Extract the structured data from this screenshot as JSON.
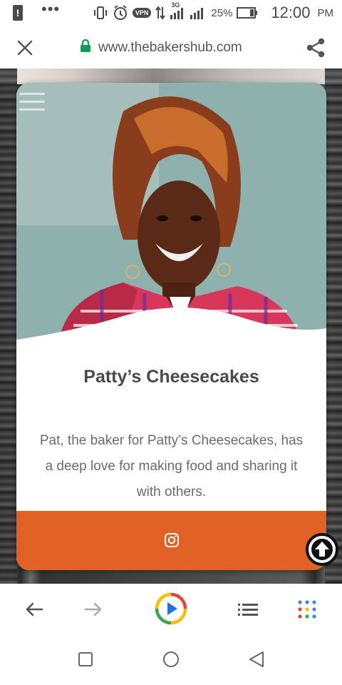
{
  "status_bar": {
    "alert_glyph": "!",
    "dots": "•••",
    "vpn_label": "VPN",
    "network_label": "3G",
    "battery": "25%",
    "time": "12:00",
    "ampm": "PM"
  },
  "address_bar": {
    "url": "www.thebakershub.com"
  },
  "card": {
    "title": "Patty’s Cheesecakes",
    "description": "Pat, the baker for Patty’s Cheesecakes, has a deep love for making food and sharing it with others."
  },
  "colors": {
    "footer_accent": "#e26226",
    "title_text": "#4a4a4a",
    "desc_text": "#6b6b6b",
    "lock_green": "#0f9d58"
  },
  "icons": {
    "close": "close-icon",
    "lock": "lock-icon",
    "share": "share-icon",
    "menu": "hamburger-menu-icon",
    "instagram": "instagram-icon",
    "back_to_top": "arrow-up-circle-icon",
    "back": "arrow-left-icon",
    "forward": "arrow-right-icon",
    "play": "play-circle-icon",
    "list": "list-icon",
    "apps": "grid-dots-icon",
    "recent": "square-icon",
    "home": "circle-icon",
    "nav_back": "triangle-back-icon"
  }
}
